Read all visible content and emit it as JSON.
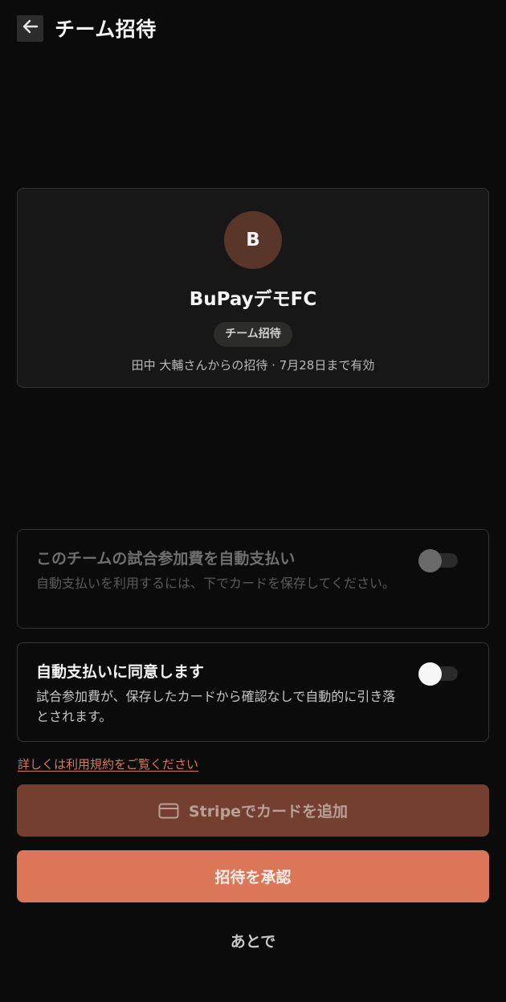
{
  "header": {
    "title": "チーム招待",
    "back_icon": "arrow-left-icon"
  },
  "team_card": {
    "avatar_letter": "B",
    "team_name": "BuPayデモFC",
    "badge": "チーム招待",
    "invite_meta": "田中 大輔さんからの招待 · 7月28日まで有効"
  },
  "autopay": {
    "title": "このチームの試合参加費を自動支払い",
    "description": "自動支払いを利用するには、下でカードを保存してください。",
    "enabled": false,
    "disabled": true
  },
  "consent": {
    "title": "自動支払いに同意します",
    "description": "試合参加費が、保存したカードから確認なしで自動的に引き落とされます。",
    "enabled": false
  },
  "terms_link": "詳しくは利用規約をご覧ください",
  "buttons": {
    "add_card": "Stripeでカードを追加",
    "add_card_icon": "credit-card-icon",
    "accept": "招待を承認",
    "later": "あとで"
  },
  "colors": {
    "background": "#0b0b0b",
    "accent": "#dc7658",
    "accent_dark": "#743f2f",
    "avatar": "#5a3529",
    "link": "#d9775a"
  }
}
